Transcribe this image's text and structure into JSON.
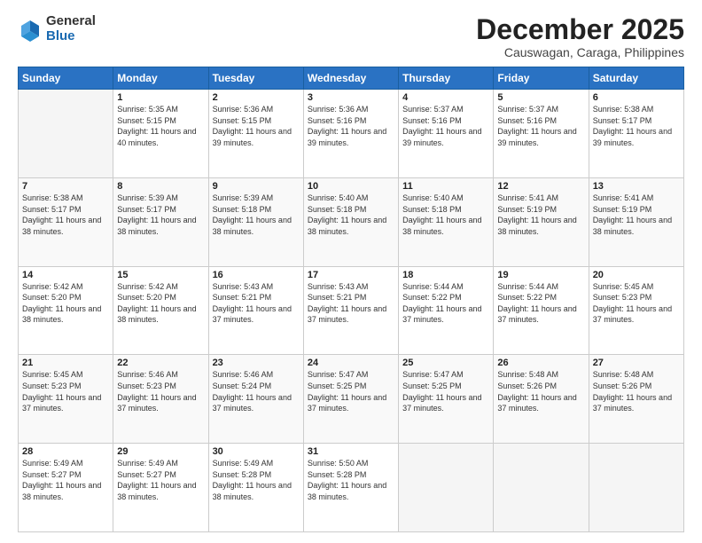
{
  "logo": {
    "general": "General",
    "blue": "Blue"
  },
  "title": "December 2025",
  "subtitle": "Causwagan, Caraga, Philippines",
  "days_header": [
    "Sunday",
    "Monday",
    "Tuesday",
    "Wednesday",
    "Thursday",
    "Friday",
    "Saturday"
  ],
  "weeks": [
    [
      {
        "day": "",
        "info": ""
      },
      {
        "day": "1",
        "info": "Sunrise: 5:35 AM\nSunset: 5:15 PM\nDaylight: 11 hours\nand 40 minutes."
      },
      {
        "day": "2",
        "info": "Sunrise: 5:36 AM\nSunset: 5:15 PM\nDaylight: 11 hours\nand 39 minutes."
      },
      {
        "day": "3",
        "info": "Sunrise: 5:36 AM\nSunset: 5:16 PM\nDaylight: 11 hours\nand 39 minutes."
      },
      {
        "day": "4",
        "info": "Sunrise: 5:37 AM\nSunset: 5:16 PM\nDaylight: 11 hours\nand 39 minutes."
      },
      {
        "day": "5",
        "info": "Sunrise: 5:37 AM\nSunset: 5:16 PM\nDaylight: 11 hours\nand 39 minutes."
      },
      {
        "day": "6",
        "info": "Sunrise: 5:38 AM\nSunset: 5:17 PM\nDaylight: 11 hours\nand 39 minutes."
      }
    ],
    [
      {
        "day": "7",
        "info": "Sunrise: 5:38 AM\nSunset: 5:17 PM\nDaylight: 11 hours\nand 38 minutes."
      },
      {
        "day": "8",
        "info": "Sunrise: 5:39 AM\nSunset: 5:17 PM\nDaylight: 11 hours\nand 38 minutes."
      },
      {
        "day": "9",
        "info": "Sunrise: 5:39 AM\nSunset: 5:18 PM\nDaylight: 11 hours\nand 38 minutes."
      },
      {
        "day": "10",
        "info": "Sunrise: 5:40 AM\nSunset: 5:18 PM\nDaylight: 11 hours\nand 38 minutes."
      },
      {
        "day": "11",
        "info": "Sunrise: 5:40 AM\nSunset: 5:18 PM\nDaylight: 11 hours\nand 38 minutes."
      },
      {
        "day": "12",
        "info": "Sunrise: 5:41 AM\nSunset: 5:19 PM\nDaylight: 11 hours\nand 38 minutes."
      },
      {
        "day": "13",
        "info": "Sunrise: 5:41 AM\nSunset: 5:19 PM\nDaylight: 11 hours\nand 38 minutes."
      }
    ],
    [
      {
        "day": "14",
        "info": "Sunrise: 5:42 AM\nSunset: 5:20 PM\nDaylight: 11 hours\nand 38 minutes."
      },
      {
        "day": "15",
        "info": "Sunrise: 5:42 AM\nSunset: 5:20 PM\nDaylight: 11 hours\nand 38 minutes."
      },
      {
        "day": "16",
        "info": "Sunrise: 5:43 AM\nSunset: 5:21 PM\nDaylight: 11 hours\nand 37 minutes."
      },
      {
        "day": "17",
        "info": "Sunrise: 5:43 AM\nSunset: 5:21 PM\nDaylight: 11 hours\nand 37 minutes."
      },
      {
        "day": "18",
        "info": "Sunrise: 5:44 AM\nSunset: 5:22 PM\nDaylight: 11 hours\nand 37 minutes."
      },
      {
        "day": "19",
        "info": "Sunrise: 5:44 AM\nSunset: 5:22 PM\nDaylight: 11 hours\nand 37 minutes."
      },
      {
        "day": "20",
        "info": "Sunrise: 5:45 AM\nSunset: 5:23 PM\nDaylight: 11 hours\nand 37 minutes."
      }
    ],
    [
      {
        "day": "21",
        "info": "Sunrise: 5:45 AM\nSunset: 5:23 PM\nDaylight: 11 hours\nand 37 minutes."
      },
      {
        "day": "22",
        "info": "Sunrise: 5:46 AM\nSunset: 5:23 PM\nDaylight: 11 hours\nand 37 minutes."
      },
      {
        "day": "23",
        "info": "Sunrise: 5:46 AM\nSunset: 5:24 PM\nDaylight: 11 hours\nand 37 minutes."
      },
      {
        "day": "24",
        "info": "Sunrise: 5:47 AM\nSunset: 5:25 PM\nDaylight: 11 hours\nand 37 minutes."
      },
      {
        "day": "25",
        "info": "Sunrise: 5:47 AM\nSunset: 5:25 PM\nDaylight: 11 hours\nand 37 minutes."
      },
      {
        "day": "26",
        "info": "Sunrise: 5:48 AM\nSunset: 5:26 PM\nDaylight: 11 hours\nand 37 minutes."
      },
      {
        "day": "27",
        "info": "Sunrise: 5:48 AM\nSunset: 5:26 PM\nDaylight: 11 hours\nand 37 minutes."
      }
    ],
    [
      {
        "day": "28",
        "info": "Sunrise: 5:49 AM\nSunset: 5:27 PM\nDaylight: 11 hours\nand 38 minutes."
      },
      {
        "day": "29",
        "info": "Sunrise: 5:49 AM\nSunset: 5:27 PM\nDaylight: 11 hours\nand 38 minutes."
      },
      {
        "day": "30",
        "info": "Sunrise: 5:49 AM\nSunset: 5:28 PM\nDaylight: 11 hours\nand 38 minutes."
      },
      {
        "day": "31",
        "info": "Sunrise: 5:50 AM\nSunset: 5:28 PM\nDaylight: 11 hours\nand 38 minutes."
      },
      {
        "day": "",
        "info": ""
      },
      {
        "day": "",
        "info": ""
      },
      {
        "day": "",
        "info": ""
      }
    ]
  ]
}
